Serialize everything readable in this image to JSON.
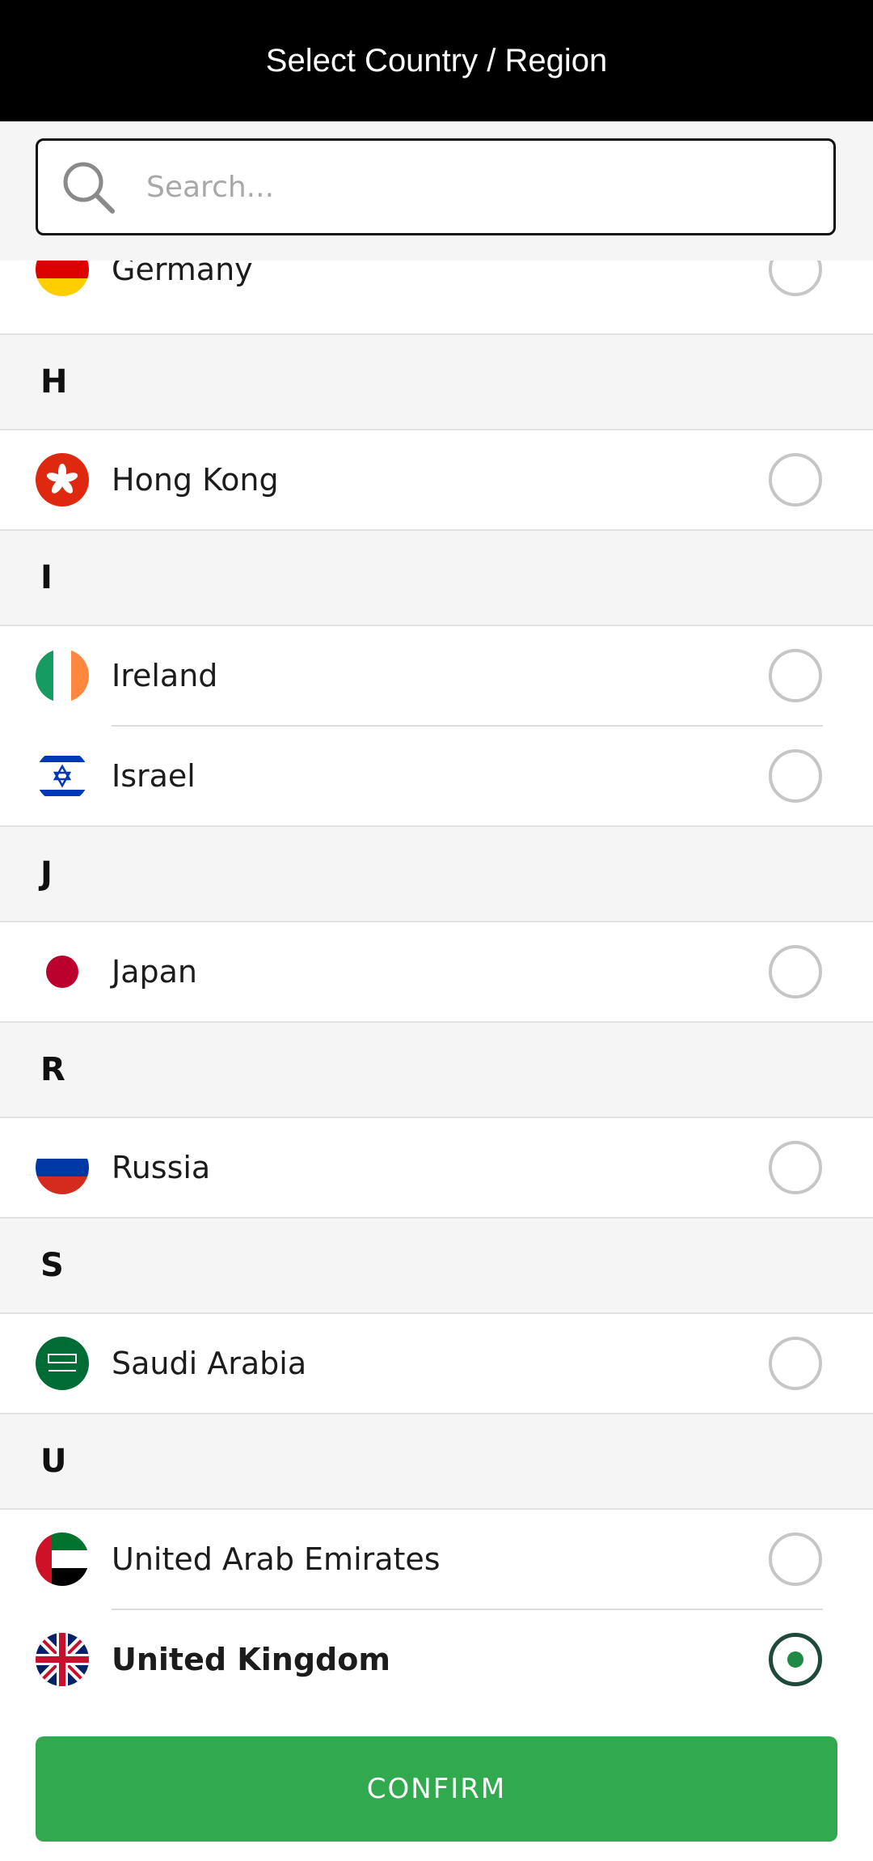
{
  "header": {
    "title": "Select Country / Region"
  },
  "search": {
    "placeholder": "Search..."
  },
  "list": [
    {
      "type": "country",
      "name": "Germany",
      "flag": "germany-flag-icon",
      "selected": false
    },
    {
      "type": "header",
      "letter": "H"
    },
    {
      "type": "country",
      "name": "Hong Kong",
      "flag": "hong-kong-flag-icon",
      "selected": false
    },
    {
      "type": "header",
      "letter": "I"
    },
    {
      "type": "country",
      "name": "Ireland",
      "flag": "ireland-flag-icon",
      "selected": false
    },
    {
      "type": "country",
      "name": "Israel",
      "flag": "israel-flag-icon",
      "selected": false
    },
    {
      "type": "header",
      "letter": "J"
    },
    {
      "type": "country",
      "name": "Japan",
      "flag": "japan-flag-icon",
      "selected": false
    },
    {
      "type": "header",
      "letter": "R"
    },
    {
      "type": "country",
      "name": "Russia",
      "flag": "russia-flag-icon",
      "selected": false
    },
    {
      "type": "header",
      "letter": "S"
    },
    {
      "type": "country",
      "name": "Saudi Arabia",
      "flag": "saudi-arabia-flag-icon",
      "selected": false
    },
    {
      "type": "header",
      "letter": "U"
    },
    {
      "type": "country",
      "name": "United Arab Emirates",
      "flag": "uae-flag-icon",
      "selected": false
    },
    {
      "type": "country",
      "name": "United Kingdom",
      "flag": "uk-flag-icon",
      "selected": true
    }
  ],
  "confirm_label": "CONFIRM",
  "colors": {
    "topbar": "#000000",
    "confirm": "#31a94e",
    "radio_selected_ring": "#1f4a3a",
    "radio_selected_dot": "#1f8a45",
    "section_bg": "#f5f5f5"
  }
}
